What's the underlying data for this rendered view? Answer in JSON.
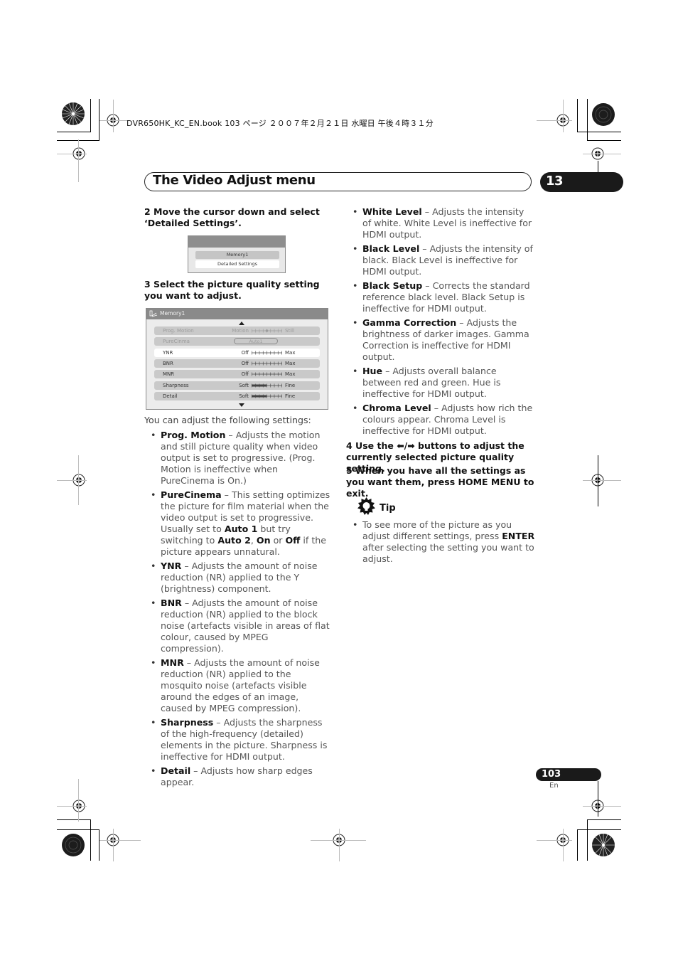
{
  "file_header": "DVR650HK_KC_EN.book  103 ページ  ２００７年２月２１日  水曜日  午後４時３１分",
  "header": {
    "title": "The Video Adjust menu",
    "chapter": "13"
  },
  "steps": {
    "step2": "2    Move the cursor down and select ‘Detailed Settings’.",
    "step3": "3    Select the picture quality setting you want to adjust.",
    "step4_prefix": "4    Use the ",
    "step4_arrows": "⬅/➡",
    "step4_suffix": " buttons to adjust the currently selected picture quality setting.",
    "step5": "5    When you have all the settings as you want them, press HOME MENU to exit."
  },
  "osd_menu": {
    "items": [
      "Memory1",
      "Detailed Settings"
    ]
  },
  "osd_settings": {
    "title": "Memory1",
    "rows": [
      {
        "label": "Prog. Motion",
        "low": "Motion",
        "high": "Still",
        "type": "scale",
        "value": 0.5,
        "dim": true
      },
      {
        "label": "PureCinma",
        "value_text": "Auto1",
        "type": "pill",
        "dim": true
      },
      {
        "label": "YNR",
        "low": "Off",
        "high": "Max",
        "type": "scale",
        "value": 0,
        "selected": true
      },
      {
        "label": "BNR",
        "low": "Off",
        "high": "Max",
        "type": "scale",
        "value": 0
      },
      {
        "label": "MNR",
        "low": "Off",
        "high": "Max",
        "type": "scale",
        "value": 0
      },
      {
        "label": "Sharpness",
        "low": "Soft",
        "high": "Fine",
        "type": "bar",
        "value": 0.5
      },
      {
        "label": "Detail",
        "low": "Soft",
        "high": "Fine",
        "type": "bar",
        "value": 0.5
      }
    ]
  },
  "intro": "You can adjust the following settings:",
  "left_bullets": [
    {
      "term": "Prog. Motion",
      "desc": " – Adjusts the motion and still picture quality when video output is set to progressive. (Prog. Motion is ineffective when PureCinema is On.)"
    },
    {
      "term": "PureCinema",
      "desc": " – This setting optimizes the picture for film material when the video output is set to progressive. Usually set to ",
      "b1": "Auto 1",
      "m1": " but try switching to ",
      "b2": "Auto 2",
      "m2": ", ",
      "b3": "On",
      "m3": " or ",
      "b4": "Off",
      "m4": " if the picture appears unnatural."
    },
    {
      "term": "YNR",
      "desc": " – Adjusts the amount of noise reduction (NR) applied to the Y (brightness) component."
    },
    {
      "term": "BNR",
      "desc": " – Adjusts the amount of noise reduction (NR) applied to the block noise (artefacts visible in areas of flat colour, caused by MPEG compression)."
    },
    {
      "term": "MNR",
      "desc": " – Adjusts the amount of noise reduction (NR) applied to the mosquito noise (artefacts visible around the edges of an image, caused by MPEG compression)."
    },
    {
      "term": "Sharpness",
      "desc": " – Adjusts the sharpness of the high-frequency (detailed) elements in the picture. Sharpness is ineffective for HDMI output."
    },
    {
      "term": "Detail",
      "desc": " – Adjusts how sharp edges appear."
    }
  ],
  "right_bullets": [
    {
      "term": "White Level",
      "desc": " – Adjusts the intensity of white. White Level is ineffective for HDMI output."
    },
    {
      "term": "Black Level",
      "desc": " – Adjusts the intensity of black. Black Level is ineffective for HDMI output."
    },
    {
      "term": "Black Setup",
      "desc": " – Corrects the standard reference black level. Black Setup is ineffective for HDMI output."
    },
    {
      "term": "Gamma Correction",
      "desc": " – Adjusts the brightness of darker images. Gamma Correction is ineffective for HDMI output."
    },
    {
      "term": "Hue",
      "desc": " – Adjusts overall balance between red and green. Hue is ineffective for HDMI output."
    },
    {
      "term": "Chroma Level",
      "desc": " – Adjusts how rich the colours appear. Chroma Level is ineffective for HDMI output."
    }
  ],
  "tip": {
    "title": "Tip",
    "pre": "To see more of the picture as you adjust different settings, press ",
    "bold": "ENTER",
    "post": " after selecting the setting you want to adjust."
  },
  "footer": {
    "page": "103",
    "lang": "En"
  }
}
